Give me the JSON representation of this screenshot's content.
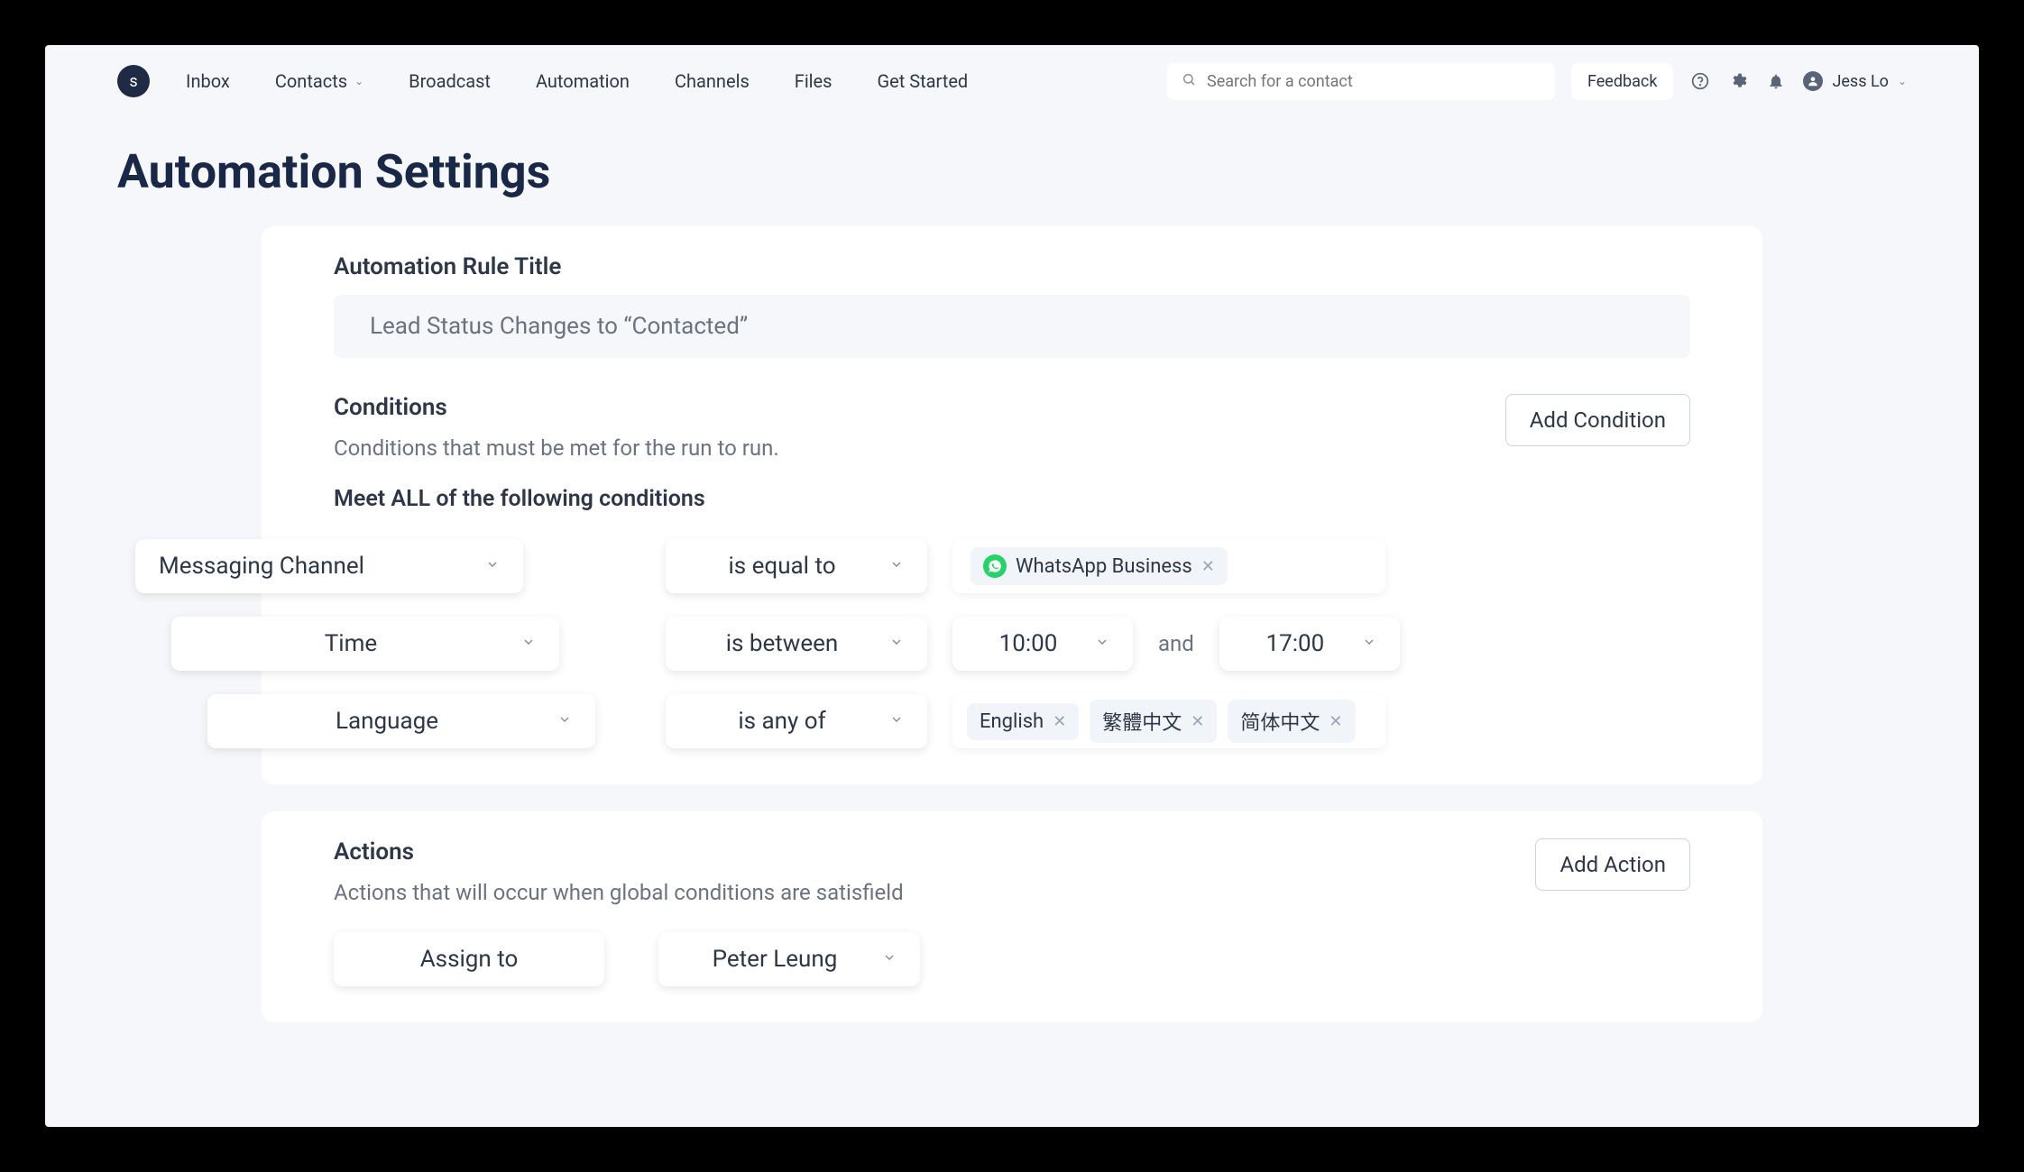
{
  "logo_letter": "s",
  "nav": {
    "inbox": "Inbox",
    "contacts": "Contacts",
    "broadcast": "Broadcast",
    "automation": "Automation",
    "channels": "Channels",
    "files": "Files",
    "get_started": "Get Started"
  },
  "search_placeholder": "Search for a contact",
  "feedback_label": "Feedback",
  "user_name": "Jess Lo",
  "page_title": "Automation Settings",
  "rule_title_label": "Automation Rule Title",
  "rule_title_value": "Lead Status Changes to “Contacted”",
  "conditions": {
    "label": "Conditions",
    "subtitle": "Conditions that must be met for the run to run.",
    "meet_all": "Meet ALL of the following conditions",
    "add_label": "Add Condition",
    "row1": {
      "field": "Messaging Channel",
      "op": "is equal to",
      "chip": "WhatsApp Business"
    },
    "row2": {
      "field": "Time",
      "op": "is between",
      "time1": "10:00",
      "and": "and",
      "time2": "17:00"
    },
    "row3": {
      "field": "Language",
      "op": "is any of",
      "chip1": "English",
      "chip2": "繁體中文",
      "chip3": "简体中文"
    }
  },
  "actions": {
    "label": "Actions",
    "subtitle": "Actions that will occur when global conditions are satisfield",
    "add_label": "Add Action",
    "row1": {
      "field": "Assign to",
      "value": "Peter Leung"
    }
  }
}
